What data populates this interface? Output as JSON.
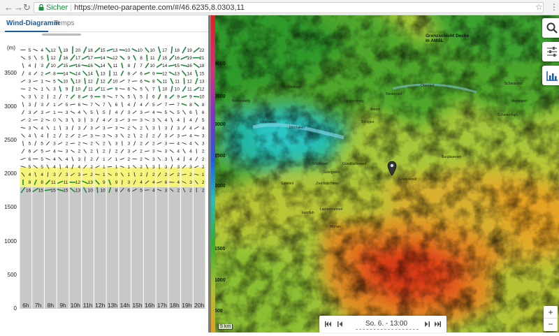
{
  "browser": {
    "secure_label": "Sicher",
    "url": "https://meteo-parapente.com/#/46.6235,8.0303,11"
  },
  "tabs": [
    {
      "label": "Wind-Diagramm",
      "active": true
    },
    {
      "label": "Temps",
      "active": false
    }
  ],
  "diagram": {
    "unit": "(m)",
    "y_ticks": [
      "3500",
      "3000",
      "2500",
      "2000",
      "1500",
      "1000",
      "500",
      "0"
    ],
    "hours": [
      "6h",
      "7h",
      "8h",
      "9h",
      "10h",
      "11h",
      "12h",
      "13h",
      "14h",
      "15h",
      "16h",
      "17h",
      "18h",
      "19h",
      "20h"
    ],
    "ground_top_m": 1850,
    "cloud_layer_m": [
      1950,
      2100
    ],
    "max_m": 3900,
    "rows": [
      [
        "5",
        "4",
        "12",
        "19",
        "20",
        "18",
        "15",
        "13",
        "10",
        "10",
        "10",
        "17",
        "18",
        "19",
        "22"
      ],
      [
        "5",
        "5",
        "12",
        "16",
        "17",
        "17",
        "14",
        "12",
        "9",
        "8",
        "11",
        "15",
        "16",
        "19",
        "21"
      ],
      [
        "4",
        "3",
        "10",
        "15",
        "16",
        "16",
        "14",
        "11",
        "8",
        "7",
        "10",
        "14",
        "15",
        "16",
        "18"
      ],
      [
        "4",
        "2",
        "8",
        "14",
        "14",
        "14",
        "13",
        "11",
        "8",
        "6",
        "9",
        "12",
        "13",
        "14",
        "15"
      ],
      [
        "3",
        "1",
        "5",
        "10",
        "13",
        "12",
        "12",
        "10",
        "7",
        "6",
        "8",
        "11",
        "11",
        "12",
        "13"
      ],
      [
        "2",
        "1",
        "3",
        "9",
        "10",
        "11",
        "11",
        "9",
        "6",
        "5",
        "7",
        "10",
        "10",
        "11",
        "12"
      ],
      [
        "3",
        "2",
        "2",
        "7",
        "8",
        "9",
        "9",
        "7",
        "5",
        "5",
        "6",
        "8",
        "9",
        "9",
        "10"
      ],
      [
        "3",
        "3",
        "1",
        "5",
        "6",
        "7",
        "7",
        "6",
        "4",
        "4",
        "5",
        "7",
        "7",
        "8",
        "8"
      ],
      [
        "3",
        "3",
        "1",
        "3",
        "4",
        "5",
        "5",
        "4",
        "3",
        "3",
        "4",
        "5",
        "5",
        "6",
        "6"
      ],
      [
        "2",
        "2",
        "0",
        "3",
        "3",
        "3",
        "4",
        "3",
        "3",
        "3",
        "3",
        "4",
        "4",
        "4",
        "5"
      ],
      [
        "3",
        "4",
        "1",
        "3",
        "3",
        "3",
        "3",
        "3",
        "2",
        "2",
        "3",
        "3",
        "3",
        "4",
        "4"
      ],
      [
        "4",
        "4",
        "2",
        "2",
        "2",
        "3",
        "3",
        "3",
        "2",
        "2",
        "2",
        "3",
        "3",
        "4",
        "3"
      ],
      [
        "5",
        "5",
        "3",
        "2",
        "2",
        "2",
        "2",
        "3",
        "3",
        "2",
        "2",
        "3",
        "4",
        "4",
        "3"
      ],
      [
        "6",
        "5",
        "4",
        "3",
        "2",
        "2",
        "2",
        "2",
        "3",
        "2",
        "3",
        "3",
        "4",
        "4",
        "2"
      ],
      [
        "6",
        "5",
        "4",
        "4",
        "3",
        "2",
        "1",
        "1",
        "2",
        "2",
        "3",
        "3",
        "4",
        "4",
        "2"
      ],
      [
        "5",
        "5",
        "4",
        "4",
        "4",
        "2",
        "1",
        "1",
        "1",
        "2",
        "3",
        "3",
        "3",
        "3",
        "2"
      ],
      [
        "4",
        "4",
        "3",
        "3",
        "3",
        "2",
        "1",
        "0",
        "1",
        "2",
        "2",
        "2",
        "2",
        "2",
        "1"
      ],
      [
        "8",
        "8",
        "11",
        "11",
        "12",
        "13",
        "9",
        "9",
        "3",
        "4",
        "4",
        "6",
        "4",
        "3",
        "2"
      ],
      [
        "16",
        "15",
        "15",
        "15",
        "13",
        "10",
        "10",
        "8",
        "6",
        "5",
        "4",
        "3",
        "2",
        "2",
        "2"
      ]
    ]
  },
  "map": {
    "legend_title": "Grenzschicht Decke",
    "legend_unit": "m AMSL",
    "legend_values": [
      "4000",
      "3500",
      "3000",
      "2500",
      "2000"
    ],
    "extra_values": [
      "1500",
      "1000",
      "500"
    ],
    "scale_label": "5 km",
    "towns": [
      "Interlaken",
      "Brienz",
      "Grindelwald",
      "Lauterbrunnen",
      "Wilderswil",
      "Zweilütschinen",
      "Gündlischwand",
      "Meiringen",
      "Schattenhalb",
      "Saxeten",
      "Isenfluh",
      "Mürren",
      "Burglauenen",
      "Unterseen",
      "Ringgenberg",
      "Niederried",
      "Oberried",
      "Bönigen",
      "Habkern",
      "Beatenberg",
      "Gsteigwiler",
      "Schwanden"
    ],
    "time_label": "So. 6. - 13:00"
  },
  "icons": {
    "search": "search-icon",
    "settings": "sliders-icon",
    "chart": "bar-chart-icon",
    "marker": "map-pin-icon"
  }
}
